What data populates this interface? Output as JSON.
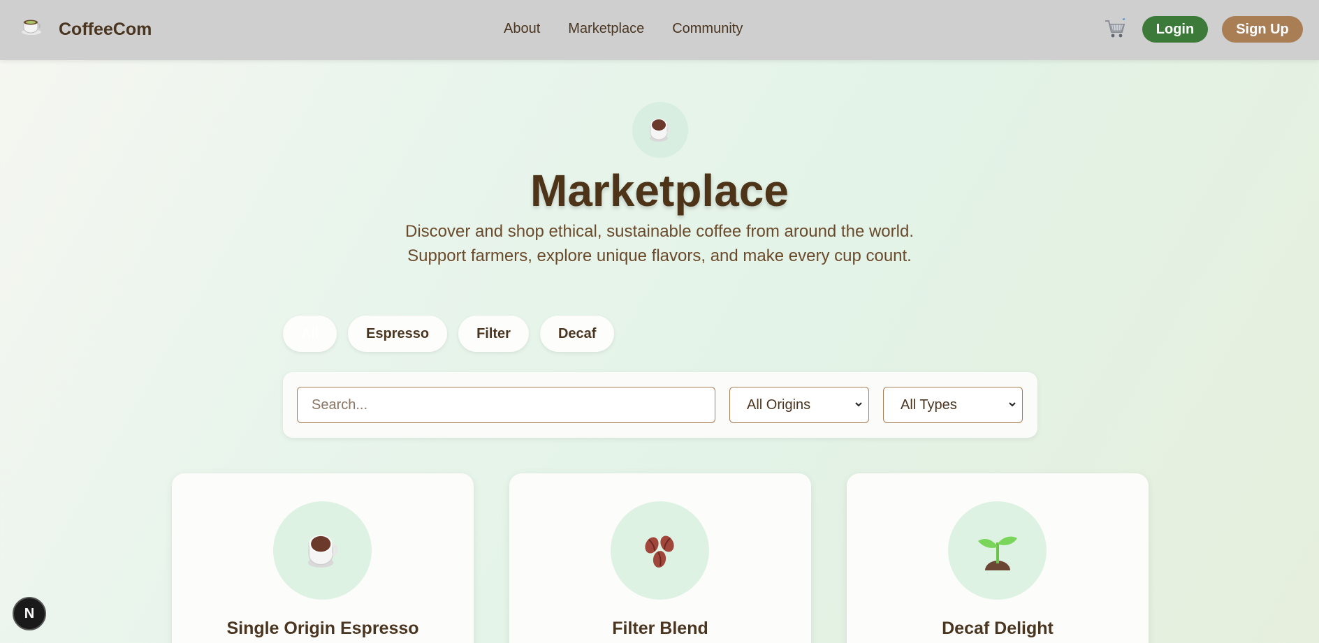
{
  "nav": {
    "brand": "CoffeeCom",
    "logo_icon": "coffee-cup-icon",
    "links": [
      {
        "label": "About"
      },
      {
        "label": "Marketplace"
      },
      {
        "label": "Community"
      }
    ],
    "cart_icon": "shopping-cart-icon",
    "login_label": "Login",
    "signup_label": "Sign Up",
    "colors": {
      "login": "#3c7a3a",
      "signup": "#a97e55",
      "bar": "#cfcfcf"
    }
  },
  "hero": {
    "icon": "coffee-cup-icon",
    "title": "Marketplace",
    "subtitle_line1": "Discover and shop ethical, sustainable coffee from around the world.",
    "subtitle_line2": "Support farmers, explore unique flavors, and make every cup count."
  },
  "filters": {
    "chips": [
      {
        "label": "All",
        "active": true
      },
      {
        "label": "Espresso",
        "active": false
      },
      {
        "label": "Filter",
        "active": false
      },
      {
        "label": "Decaf",
        "active": false
      }
    ]
  },
  "search": {
    "placeholder": "Search...",
    "origin_selected": "All Origins",
    "type_selected": "All Types"
  },
  "products": [
    {
      "title": "Single Origin Espresso",
      "icon": "coffee-cup-icon"
    },
    {
      "title": "Filter Blend",
      "icon": "coffee-beans-icon"
    },
    {
      "title": "Decaf Delight",
      "icon": "seedling-icon"
    }
  ],
  "dev_badge": {
    "label": "N"
  }
}
